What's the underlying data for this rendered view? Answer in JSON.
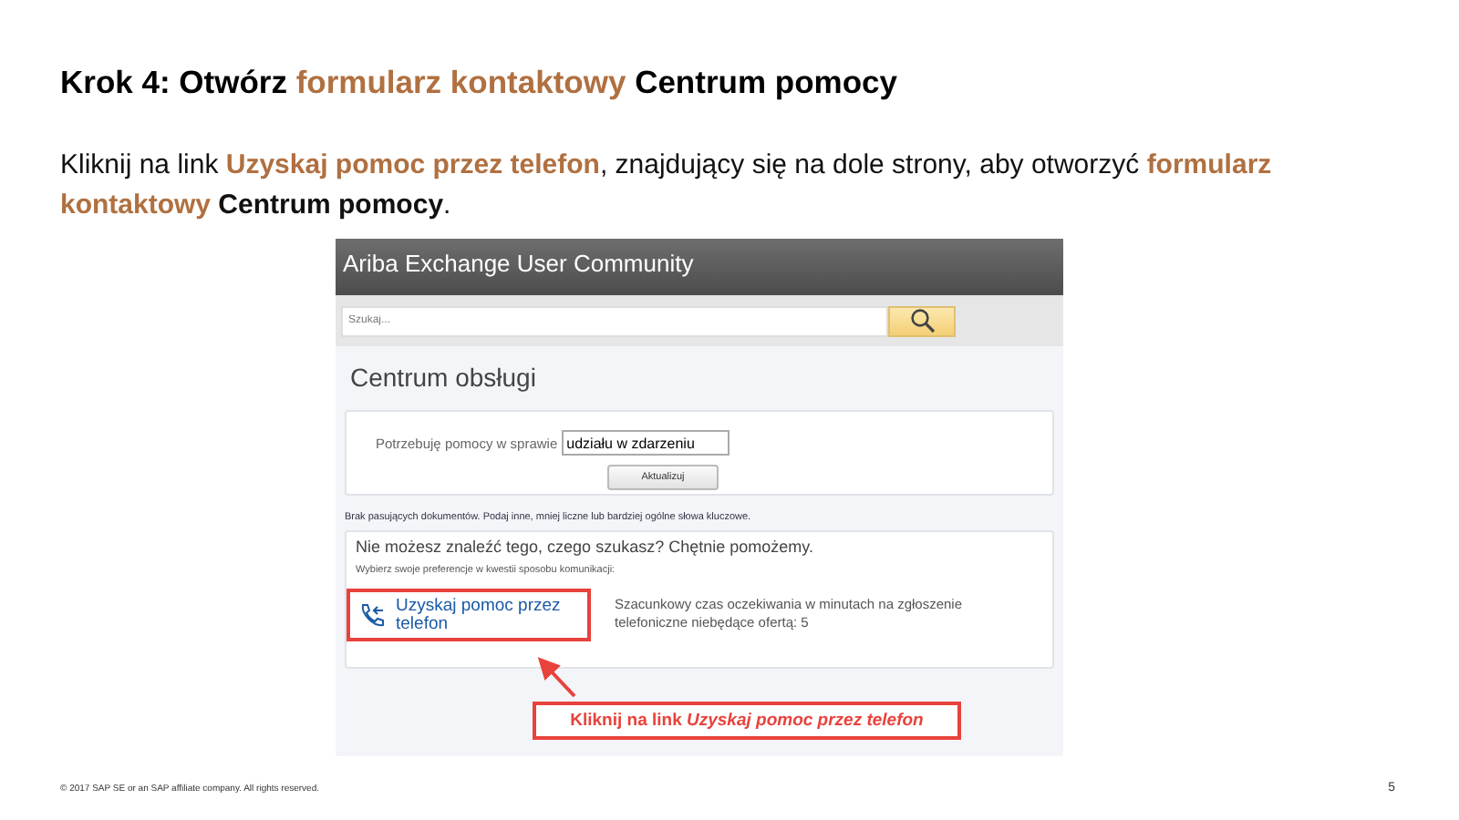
{
  "slide": {
    "title": [
      {
        "text": "Krok 4: Otwórz ",
        "kind": "plain"
      },
      {
        "text": "formularz kontaktowy",
        "kind": "accent"
      },
      {
        "text": " Centrum pomocy",
        "kind": "plain"
      }
    ],
    "instruction": [
      {
        "text": "Kliknij na link ",
        "kind": "plain"
      },
      {
        "text": "Uzyskaj pomoc przez telefon",
        "kind": "accent"
      },
      {
        "text": ", znajdujący się na dole strony, aby otworzyć ",
        "kind": "plain"
      },
      {
        "text": "formularz kontaktowy",
        "kind": "accent"
      },
      {
        "text": " Centrum pomocy",
        "kind": "bold"
      },
      {
        "text": ".",
        "kind": "plain"
      }
    ],
    "footer": "© 2017 SAP SE or an SAP affiliate company. All rights reserved.",
    "page_number": "5"
  },
  "screenshot": {
    "header_title": "Ariba Exchange User Community",
    "search": {
      "placeholder": "Szukaj..."
    },
    "page_title": "Centrum obsługi",
    "topic_label": "Potrzebuję pomocy w sprawie",
    "topic_value": "udziału w zdarzeniu",
    "update_button": "Aktualizuj",
    "no_results": "Brak pasujących dokumentów. Podaj inne, mniej liczne lub bardziej ogólne słowa kluczowe.",
    "help_heading": "Nie możesz znaleźć tego, czego szukasz? Chętnie pomożemy.",
    "help_prompt": "Wybierz swoje preferencje w kwestii sposobu komunikacji:",
    "phone_link": "Uzyskaj pomoc przez telefon",
    "wait_note": "Szacunkowy czas oczekiwania w minutach na zgłoszenie telefoniczne niebędące ofertą: 5",
    "callout": "Kliknij na link *Uzyskaj pomoc przez telefon*"
  }
}
